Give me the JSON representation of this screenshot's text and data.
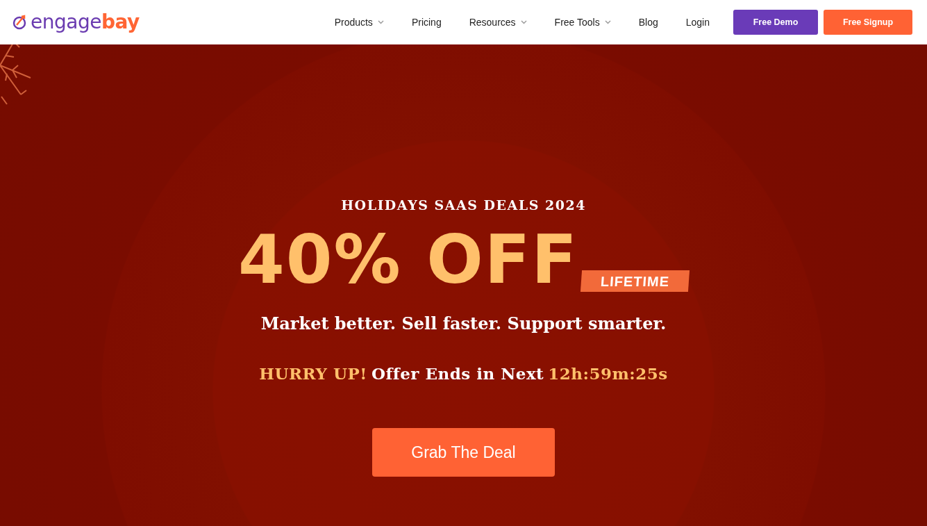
{
  "logo": {
    "parts": [
      "engage",
      "bay"
    ]
  },
  "nav": {
    "items": [
      {
        "label": "Products",
        "has_dropdown": true
      },
      {
        "label": "Pricing",
        "has_dropdown": false
      },
      {
        "label": "Resources",
        "has_dropdown": true
      },
      {
        "label": "Free Tools",
        "has_dropdown": true
      },
      {
        "label": "Blog",
        "has_dropdown": false
      },
      {
        "label": "Login",
        "has_dropdown": false
      }
    ],
    "buttons": [
      {
        "label": "Free Demo",
        "kind": "demo"
      },
      {
        "label": "Free Signup",
        "kind": "signup"
      }
    ]
  },
  "hero": {
    "eyebrow": "HOLIDAYS SAAS DEALS 2024",
    "headline": "40% OFF",
    "tag": "LIFETIME",
    "tagline": "Market better. Sell faster. Support smarter.",
    "urgency": "HURRY UP!",
    "offer_text": "Offer Ends in Next",
    "countdown": "12h:59m:25s",
    "cta": "Grab The Deal"
  }
}
